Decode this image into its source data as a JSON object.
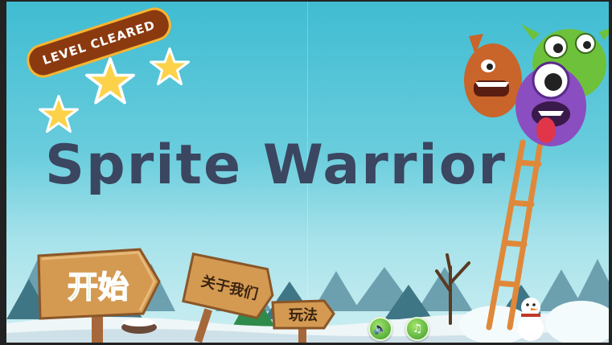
{
  "game": {
    "title": "Sprite Warrior",
    "badge_text": "LEVEL CLEARED",
    "stars_earned": 3,
    "buttons": {
      "start_label": "开始",
      "about_label": "关于我们",
      "howto_label": "玩法"
    },
    "audio": {
      "sound_icon": "speaker-icon",
      "music_icon": "music-note-icon"
    }
  },
  "colors": {
    "sky_top": "#40bcd2",
    "title_text": "#3b4660",
    "badge_fill": "#8b3a10",
    "badge_border": "#f7b531",
    "start_text": "#3fc12f",
    "wood": "#d49a52",
    "ladder": "#e0883a"
  }
}
